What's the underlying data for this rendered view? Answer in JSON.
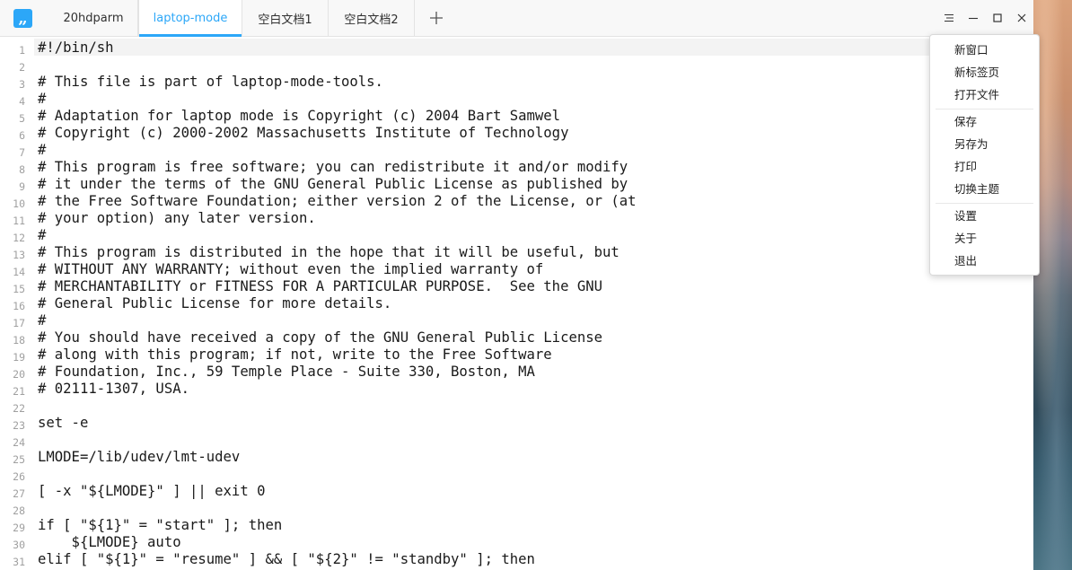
{
  "app": {
    "icon_name": "deepin-editor-icon",
    "accent_color": "#2ca7f8"
  },
  "tabs": [
    {
      "label": "20hdparm",
      "active": false
    },
    {
      "label": "laptop-mode",
      "active": true
    },
    {
      "label": "空白文档1",
      "active": false
    },
    {
      "label": "空白文档2",
      "active": false
    }
  ],
  "tab_add_icon": "plus-icon",
  "window_controls": [
    "menu-icon",
    "minimize-icon",
    "maximize-icon",
    "close-icon"
  ],
  "menu": {
    "items": [
      "新窗口",
      "新标签页",
      "打开文件",
      "保存",
      "另存为",
      "打印",
      "切换主题",
      "设置",
      "关于",
      "退出"
    ]
  },
  "editor": {
    "current_line": 1,
    "line_numbers": [
      "1",
      "2",
      "3",
      "4",
      "5",
      "6",
      "7",
      "8",
      "9",
      "10",
      "11",
      "12",
      "13",
      "14",
      "15",
      "16",
      "17",
      "18",
      "19",
      "20",
      "21",
      "22",
      "23",
      "24",
      "25",
      "26",
      "27",
      "28",
      "29",
      "30",
      "31"
    ],
    "lines": [
      "#!/bin/sh",
      "",
      "# This file is part of laptop-mode-tools.",
      "#",
      "# Adaptation for laptop mode is Copyright (c) 2004 Bart Samwel",
      "# Copyright (c) 2000-2002 Massachusetts Institute of Technology",
      "#",
      "# This program is free software; you can redistribute it and/or modify",
      "# it under the terms of the GNU General Public License as published by",
      "# the Free Software Foundation; either version 2 of the License, or (at",
      "# your option) any later version.",
      "#",
      "# This program is distributed in the hope that it will be useful, but",
      "# WITHOUT ANY WARRANTY; without even the implied warranty of",
      "# MERCHANTABILITY or FITNESS FOR A PARTICULAR PURPOSE.  See the GNU",
      "# General Public License for more details.",
      "#",
      "# You should have received a copy of the GNU General Public License",
      "# along with this program; if not, write to the Free Software",
      "# Foundation, Inc., 59 Temple Place - Suite 330, Boston, MA",
      "# 02111-1307, USA.",
      "",
      "set -e",
      "",
      "LMODE=/lib/udev/lmt-udev",
      "",
      "[ -x \"${LMODE}\" ] || exit 0",
      "",
      "if [ \"${1}\" = \"start\" ]; then",
      "    ${LMODE} auto",
      "elif [ \"${1}\" = \"resume\" ] && [ \"${2}\" != \"standby\" ]; then"
    ]
  }
}
